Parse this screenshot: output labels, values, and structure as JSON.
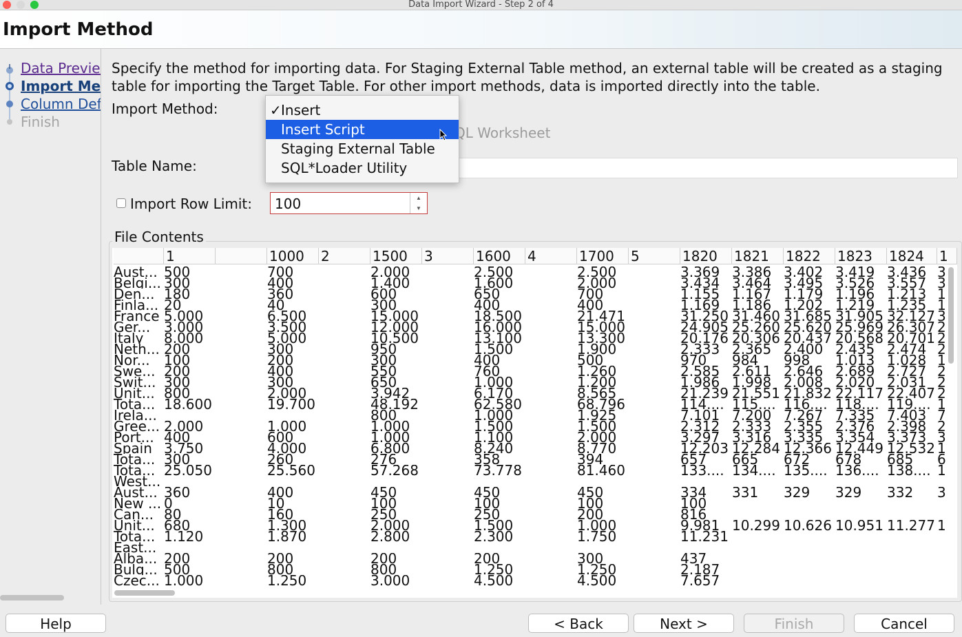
{
  "window": {
    "title": "Data Import Wizard - Step 2 of 4"
  },
  "header": {
    "title": "Import Method"
  },
  "nav": {
    "items": [
      {
        "label": "Data Preview",
        "state": "visited"
      },
      {
        "label": "Import Method",
        "state": "current"
      },
      {
        "label": "Column Definition",
        "state": "visited"
      },
      {
        "label": "Finish",
        "state": "disabled"
      }
    ]
  },
  "description": "Specify the method for importing data.  For Staging External Table method, an external table will be created as a staging table for importing the Target Table.  For other import methods, data is imported directly into the table.",
  "form": {
    "import_method_label": "Import Method:",
    "behind_text": "QL Worksheet",
    "table_name_label": "Table Name:",
    "row_limit_label": "Import Row Limit:",
    "row_limit_value": "100",
    "row_limit_checked": false
  },
  "dropdown": {
    "checkmark": "✓",
    "options": [
      {
        "label": "Insert",
        "checked": true,
        "highlighted": false
      },
      {
        "label": "Insert Script",
        "checked": false,
        "highlighted": true
      },
      {
        "label": "Staging External Table",
        "checked": false,
        "highlighted": false
      },
      {
        "label": "SQL*Loader Utility",
        "checked": false,
        "highlighted": false
      }
    ]
  },
  "file_contents": {
    "title": "File Contents",
    "columns": [
      "",
      "1",
      "",
      "1000",
      "2",
      "1500",
      "3",
      "1600",
      "4",
      "1700",
      "5",
      "1820",
      "1821",
      "1822",
      "1823",
      "1824",
      "1"
    ],
    "rows": [
      [
        "Aust...",
        "500",
        "",
        "700",
        "",
        "2.000",
        "",
        "2.500",
        "",
        "2.500",
        "",
        "3.369",
        "3.386",
        "3.402",
        "3.419",
        "3.436",
        "3"
      ],
      [
        "Belgi...",
        "300",
        "",
        "400",
        "",
        "1.400",
        "",
        "1.600",
        "",
        "2.000",
        "",
        "3.434",
        "3.464",
        "3.495",
        "3.526",
        "3.557",
        "3"
      ],
      [
        "Den...",
        "180",
        "",
        "360",
        "",
        "600",
        "",
        "650",
        "",
        "700",
        "",
        "1.155",
        "1.167",
        "1.179",
        "1.196",
        "1.213",
        "1"
      ],
      [
        "Finla...",
        "20",
        "",
        "40",
        "",
        "300",
        "",
        "400",
        "",
        "400",
        "",
        "1.169",
        "1.186",
        "1.202",
        "1.219",
        "1.235",
        "1"
      ],
      [
        "France",
        "5.000",
        "",
        "6.500",
        "",
        "15.000",
        "",
        "18.500",
        "",
        "21.471",
        "",
        "31.250",
        "31.460",
        "31.685",
        "31.905",
        "32.127",
        "3"
      ],
      [
        "Ger...",
        "3.000",
        "",
        "3.500",
        "",
        "12.000",
        "",
        "16.000",
        "",
        "15.000",
        "",
        "24.905",
        "25.260",
        "25.620",
        "25.969",
        "26.307",
        "2"
      ],
      [
        "Italy",
        "8.000",
        "",
        "5.000",
        "",
        "10.500",
        "",
        "13.100",
        "",
        "13.300",
        "",
        "20.176",
        "20.306",
        "20.437",
        "20.568",
        "20.701",
        "2"
      ],
      [
        "Neth...",
        "200",
        "",
        "300",
        "",
        "950",
        "",
        "1.500",
        "",
        "1.900",
        "",
        "2.333",
        "2.365",
        "2.400",
        "2.435",
        "2.474",
        "2"
      ],
      [
        "Nor...",
        "100",
        "",
        "200",
        "",
        "300",
        "",
        "400",
        "",
        "500",
        "",
        "970",
        "984",
        "998",
        "1.013",
        "1.028",
        "1"
      ],
      [
        "Swe...",
        "200",
        "",
        "400",
        "",
        "550",
        "",
        "760",
        "",
        "1.260",
        "",
        "2.585",
        "2.611",
        "2.646",
        "2.689",
        "2.727",
        "2"
      ],
      [
        "Swit...",
        "300",
        "",
        "300",
        "",
        "650",
        "",
        "1.000",
        "",
        "1.200",
        "",
        "1.986",
        "1.998",
        "2.008",
        "2.020",
        "2.031",
        "2"
      ],
      [
        "Unit...",
        "800",
        "",
        "2.000",
        "",
        "3.942",
        "",
        "6.170",
        "",
        "8.565",
        "",
        "21.239",
        "21.551",
        "21.832",
        "22.117",
        "22.407",
        "2"
      ],
      [
        "Tota...",
        "18.600",
        "",
        "19.700",
        "",
        "48.192",
        "",
        "62.580",
        "",
        "68.796",
        "",
        "114....",
        "115....",
        "116....",
        "118....",
        "119....",
        "1"
      ],
      [
        "Irela...",
        "",
        "",
        "",
        "",
        "800",
        "",
        "1.000",
        "",
        "1.925",
        "",
        "7.101",
        "7.200",
        "7.267",
        "7.335",
        "7.403",
        "7"
      ],
      [
        "Gree...",
        "2.000",
        "",
        "1.000",
        "",
        "1.000",
        "",
        "1.500",
        "",
        "1.500",
        "",
        "2.312",
        "2.333",
        "2.355",
        "2.376",
        "2.398",
        "2"
      ],
      [
        "Port...",
        "400",
        "",
        "600",
        "",
        "1.000",
        "",
        "1.100",
        "",
        "2.000",
        "",
        "3.297",
        "3.316",
        "3.335",
        "3.354",
        "3.373",
        "3"
      ],
      [
        "Spain",
        "3.750",
        "",
        "4.000",
        "",
        "6.800",
        "",
        "8.240",
        "",
        "8.770",
        "",
        "12.203",
        "12.284",
        "12.366",
        "12.449",
        "12.532",
        "1"
      ],
      [
        "Tota...",
        "300",
        "",
        "260",
        "",
        "276",
        "",
        "358",
        "",
        "394",
        "",
        "657",
        "665",
        "672",
        "678",
        "685",
        "6"
      ],
      [
        "Tota...",
        "25.050",
        "",
        "25.560",
        "",
        "57.268",
        "",
        "73.778",
        "",
        "81.460",
        "",
        "133....",
        "134....",
        "135....",
        "136....",
        "138....",
        "1"
      ],
      [
        "West...",
        "",
        "",
        "",
        "",
        "",
        "",
        "",
        "",
        "",
        "",
        "",
        "",
        "",
        "",
        "",
        ""
      ],
      [
        "Aust...",
        "360",
        "",
        "400",
        "",
        "450",
        "",
        "450",
        "",
        "450",
        "",
        "334",
        "331",
        "329",
        "329",
        "332",
        "3"
      ],
      [
        "New ...",
        "0",
        "",
        "10",
        "",
        "100",
        "",
        "100",
        "",
        "100",
        "",
        "100",
        "",
        "",
        "",
        "",
        ""
      ],
      [
        "Can...",
        "80",
        "",
        "160",
        "",
        "250",
        "",
        "250",
        "",
        "200",
        "",
        "816",
        "",
        "",
        "",
        "",
        ""
      ],
      [
        "Unit...",
        "680",
        "",
        "1.300",
        "",
        "2.000",
        "",
        "1.500",
        "",
        "1.000",
        "",
        "9.981",
        "10.299",
        "10.626",
        "10.951",
        "11.277",
        "1"
      ],
      [
        "Tota...",
        "1.120",
        "",
        "1.870",
        "",
        "2.800",
        "",
        "2.300",
        "",
        "1.750",
        "",
        "11.231",
        "",
        "",
        "",
        "",
        ""
      ],
      [
        "East...",
        "",
        "",
        "",
        "",
        "",
        "",
        "",
        "",
        "",
        "",
        "",
        "",
        "",
        "",
        "",
        ""
      ],
      [
        "Alba...",
        "200",
        "",
        "200",
        "",
        "200",
        "",
        "200",
        "",
        "300",
        "",
        "437",
        "",
        "",
        "",
        "",
        ""
      ],
      [
        "Bulg...",
        "500",
        "",
        "800",
        "",
        "800",
        "",
        "1.250",
        "",
        "1.250",
        "",
        "2.187",
        "",
        "",
        "",
        "",
        ""
      ],
      [
        "Czec...",
        "1.000",
        "",
        "1.250",
        "",
        "3.000",
        "",
        "4.500",
        "",
        "4.500",
        "",
        "7.657",
        "",
        "",
        "",
        "",
        ""
      ]
    ]
  },
  "buttons": {
    "help": "Help",
    "back": "< Back",
    "next": "Next >",
    "finish": "Finish",
    "cancel": "Cancel"
  },
  "colors": {
    "selection": "#1c5fe4",
    "nav_link": "#5b2a8f",
    "nav_current": "#17407a",
    "spinner_border": "#c53a3a"
  }
}
